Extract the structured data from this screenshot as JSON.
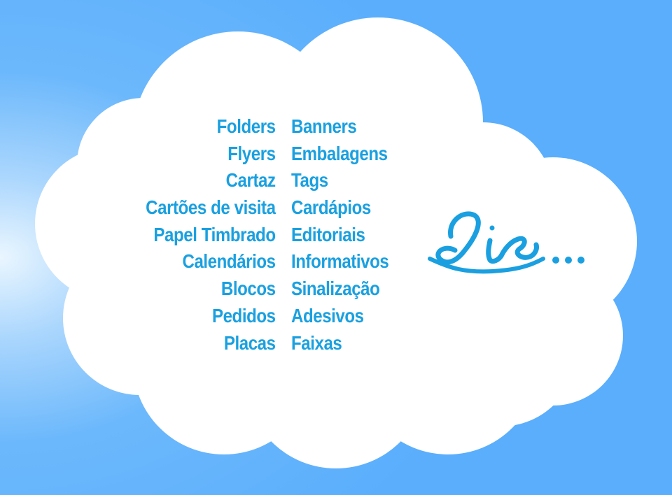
{
  "colors": {
    "sky": "#5aaefc",
    "sky_glow": "#eaf6ff",
    "cloud": "#ffffff",
    "text": "#1aa0e0"
  },
  "services_left": [
    "Folders",
    "Flyers",
    "Cartaz",
    "Cartões de visita",
    "Papel Timbrado",
    "Calendários",
    "Blocos",
    "Pedidos",
    "Placas"
  ],
  "services_right": [
    "Banners",
    "Embalagens",
    "Tags",
    "Cardápios",
    "Editoriais",
    "Informativos",
    "Sinalização",
    "Adesivos",
    "Faixas"
  ],
  "logo": {
    "text": "Lis..."
  }
}
